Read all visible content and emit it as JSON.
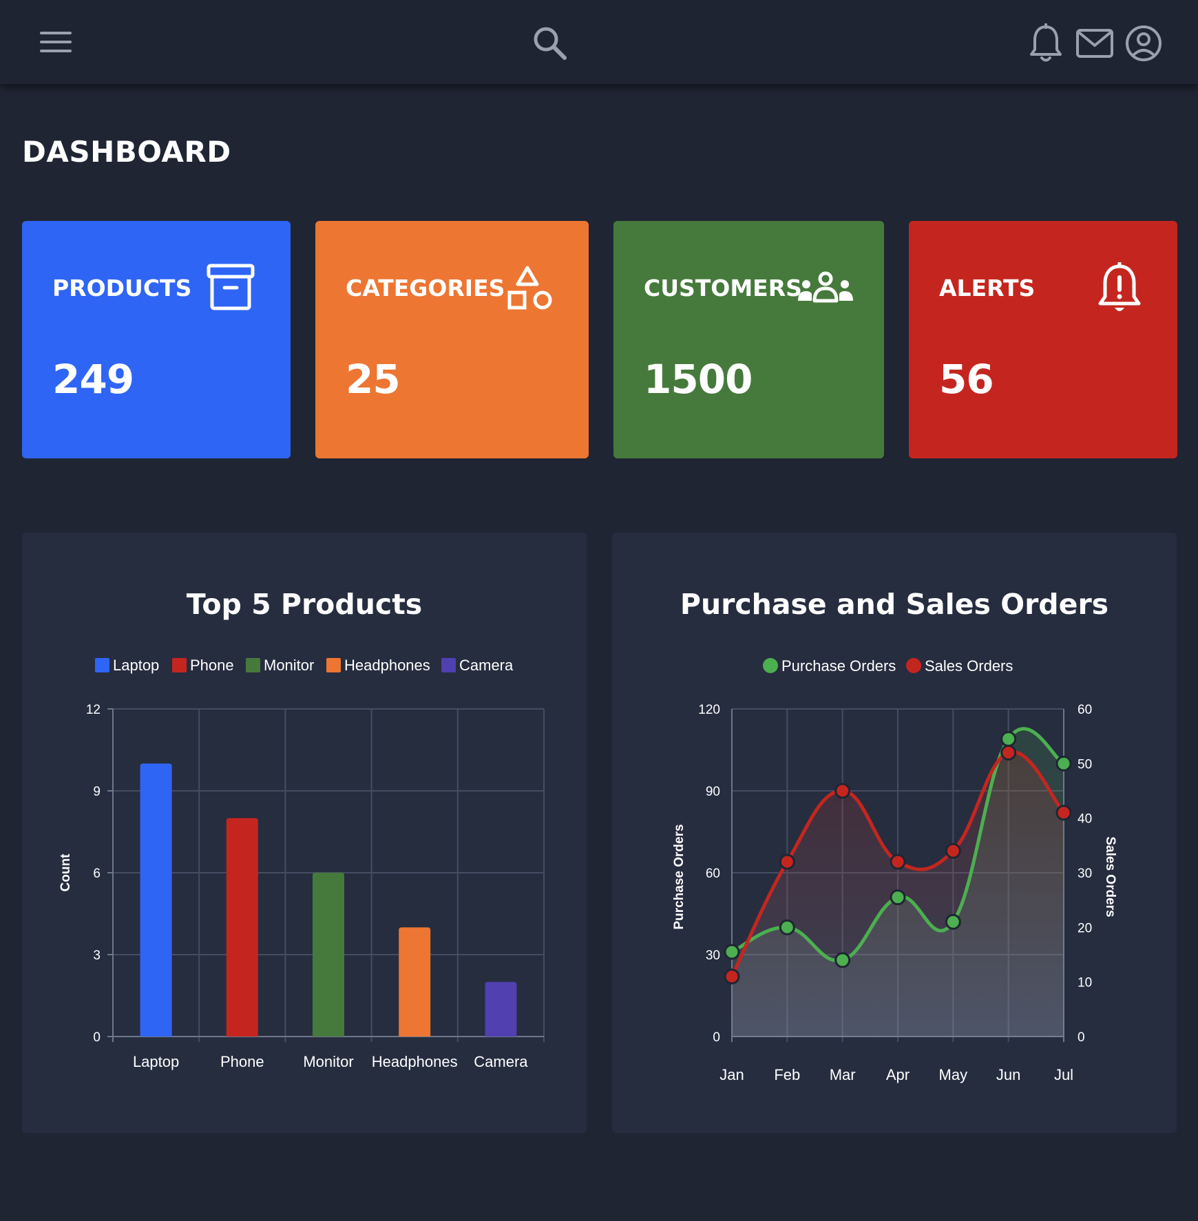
{
  "page": {
    "title": "DASHBOARD"
  },
  "topbar": {
    "menu_icon": "hamburger-menu-icon",
    "search_icon": "search-icon",
    "notifications_icon": "bell-icon",
    "mail_icon": "mail-icon",
    "account_icon": "user-circle-icon",
    "icon_color": "#9aa0ad"
  },
  "cards": [
    {
      "title": "PRODUCTS",
      "value": "249",
      "icon": "archive-box-icon",
      "color": "#2f65f5"
    },
    {
      "title": "CATEGORIES",
      "value": "25",
      "icon": "shapes-icon",
      "color": "#ed7632"
    },
    {
      "title": "CUSTOMERS",
      "value": "1500",
      "icon": "people-group-icon",
      "color": "#467a3c"
    },
    {
      "title": "ALERTS",
      "value": "56",
      "icon": "bell-exclamation-icon",
      "color": "#c4261f"
    }
  ],
  "chart_data": [
    {
      "type": "bar",
      "title": "Top 5 Products",
      "categories": [
        "Laptop",
        "Phone",
        "Monitor",
        "Headphones",
        "Camera"
      ],
      "values": [
        10,
        8,
        6,
        4,
        2
      ],
      "colors": [
        "#2f65f5",
        "#c4261f",
        "#467a3c",
        "#ed7632",
        "#5040b0"
      ],
      "legend": [
        "Laptop",
        "Phone",
        "Monitor",
        "Headphones",
        "Camera"
      ],
      "legend_position": "top",
      "xlabel": "",
      "ylabel": "Count",
      "ylim": [
        0,
        12
      ],
      "yticks": [
        "0",
        "3",
        "6",
        "9",
        "12"
      ],
      "grid": true
    },
    {
      "type": "line",
      "title": "Purchase and Sales Orders",
      "categories": [
        "Jan",
        "Feb",
        "Mar",
        "Apr",
        "May",
        "Jun",
        "Jul"
      ],
      "series": [
        {
          "name": "Purchase Orders",
          "axis": "left",
          "color": "#4caf50",
          "values": [
            31,
            40,
            28,
            51,
            42,
            109,
            100
          ]
        },
        {
          "name": "Sales Orders",
          "axis": "right",
          "color": "#c4261f",
          "values": [
            11,
            32,
            45,
            32,
            34,
            52,
            41
          ]
        }
      ],
      "legend_position": "top",
      "ylabel_left": "Purchase Orders",
      "ylabel_right": "Sales Orders",
      "ylim_left": [
        0,
        120
      ],
      "ylim_right": [
        0,
        60
      ],
      "yticks_left": [
        "0",
        "30",
        "60",
        "90",
        "120"
      ],
      "yticks_right": [
        "0",
        "10",
        "20",
        "30",
        "40",
        "50",
        "60"
      ],
      "smooth": true,
      "area_fill": true,
      "grid": true
    }
  ]
}
